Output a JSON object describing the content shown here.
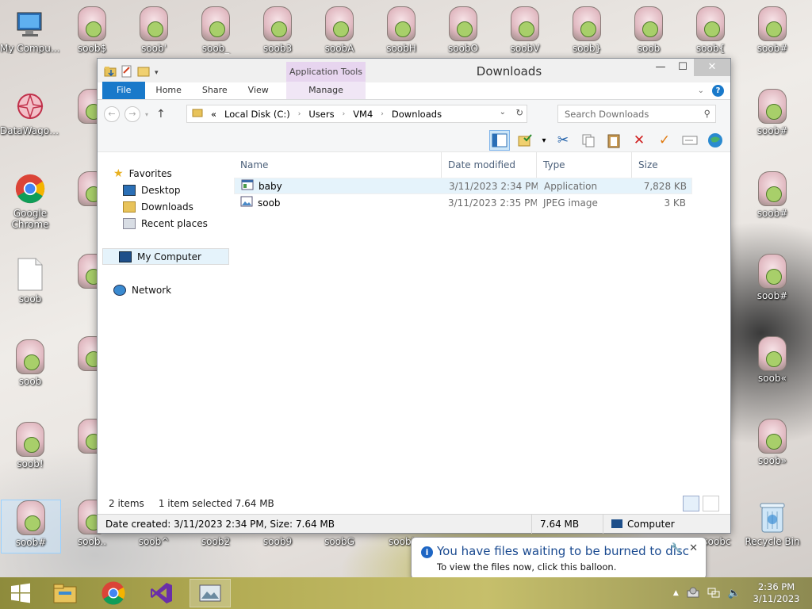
{
  "desktop": {
    "icons": [
      {
        "label": "My Computer"
      },
      {
        "label": "DataWagon..."
      },
      {
        "label": "Google Chrome"
      },
      {
        "label": "soob"
      },
      {
        "label": "soob"
      },
      {
        "label": "soob!"
      },
      {
        "label": "soob#"
      },
      {
        "label": "soob$"
      },
      {
        "label": "soob'"
      },
      {
        "label": "soob_"
      },
      {
        "label": "soob3"
      },
      {
        "label": "soobA"
      },
      {
        "label": "soobH"
      },
      {
        "label": "soobO"
      },
      {
        "label": "soobV"
      },
      {
        "label": "soob}"
      },
      {
        "label": "soob"
      },
      {
        "label": "soob{"
      },
      {
        "label": "soob#"
      },
      {
        "label": "soob.."
      },
      {
        "label": "soob^"
      },
      {
        "label": "soob2"
      },
      {
        "label": "soob9"
      },
      {
        "label": "soobG"
      },
      {
        "label": "soobl"
      },
      {
        "label": "soobc"
      },
      {
        "label": "Recycle Bin"
      },
      {
        "label": "soob#"
      },
      {
        "label": "soob#"
      },
      {
        "label": "soob#"
      },
      {
        "label": "soob«"
      },
      {
        "label": "soob»"
      }
    ]
  },
  "window": {
    "title": "Downloads",
    "app_tools": "Application Tools",
    "tabs": {
      "file": "File",
      "home": "Home",
      "share": "Share",
      "view": "View",
      "manage": "Manage"
    },
    "address": {
      "prefix": "«",
      "crumbs": [
        "Local Disk (C:)",
        "Users",
        "VM4",
        "Downloads"
      ]
    },
    "search_placeholder": "Search Downloads",
    "nav": {
      "favorites": "Favorites",
      "desktop": "Desktop",
      "downloads": "Downloads",
      "recent": "Recent places",
      "computer": "My Computer",
      "network": "Network"
    },
    "columns": {
      "name": "Name",
      "date": "Date modified",
      "type": "Type",
      "size": "Size"
    },
    "files": [
      {
        "name": "baby",
        "date": "3/11/2023 2:34 PM",
        "type": "Application",
        "size": "7,828 KB"
      },
      {
        "name": "soob",
        "date": "3/11/2023 2:35 PM",
        "type": "JPEG image",
        "size": "3 KB"
      }
    ],
    "status": {
      "items": "2 items",
      "selected": "1 item selected  7.64 MB"
    },
    "details": {
      "created": "Date created: 3/11/2023 2:34 PM, Size: 7.64 MB",
      "size": "7.64 MB",
      "location": "Computer"
    }
  },
  "balloon": {
    "title": "You have files waiting to be burned to disc",
    "subtitle": "To view the files now, click this balloon."
  },
  "clock": {
    "time": "2:36 PM",
    "date": "3/11/2023"
  }
}
